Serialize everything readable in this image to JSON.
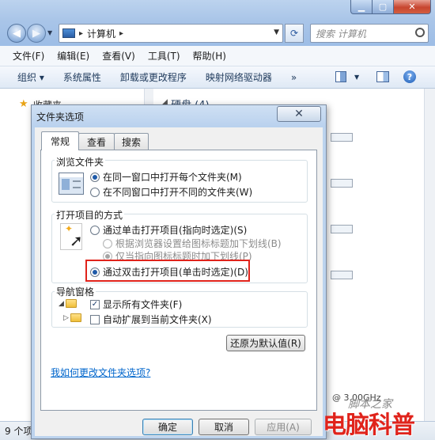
{
  "explorer": {
    "address": {
      "root_label": "计算机"
    },
    "search_placeholder": "搜索 计算机",
    "menu": [
      "文件(F)",
      "编辑(E)",
      "查看(V)",
      "工具(T)",
      "帮助(H)"
    ],
    "commands": [
      "组织 ▾",
      "系统属性",
      "卸载或更改程序",
      "映射网络驱动器",
      "»"
    ],
    "nav_pane": {
      "favorites_label": "收藏夹"
    },
    "content": {
      "group_label": "硬盘 (4)",
      "cpu_text": "@ 3.00GHz"
    },
    "status": {
      "text": "9 个项"
    },
    "watermark": {
      "text": "电脑科普",
      "script": "脚本之家"
    }
  },
  "dialog": {
    "title": "文件夹选项",
    "close_glyph": "✕",
    "tabs": [
      "常规",
      "查看",
      "搜索"
    ],
    "active_tab": 0,
    "browse_group": {
      "label": "浏览文件夹",
      "options": [
        {
          "label": "在同一窗口中打开每个文件夹(M)",
          "selected": true
        },
        {
          "label": "在不同窗口中打开不同的文件夹(W)",
          "selected": false
        }
      ]
    },
    "click_group": {
      "label": "打开项目的方式",
      "single_click": {
        "label": "通过单击打开项目(指向时选定)(S)",
        "selected": false
      },
      "underline_browser": {
        "label": "根据浏览器设置给图标标题加下划线(B)",
        "selected": false
      },
      "underline_point": {
        "label": "仅当指向图标标题时加下划线(P)",
        "selected": true
      },
      "double_click": {
        "label": "通过双击打开项目(单击时选定)(D)",
        "selected": true
      }
    },
    "nav_group": {
      "label": "导航窗格",
      "show_all": {
        "label": "显示所有文件夹(F)",
        "checked": true
      },
      "auto_expand": {
        "label": "自动扩展到当前文件夹(X)",
        "checked": false
      }
    },
    "restore_defaults": "还原为默认值(R)",
    "help_link": "我如何更改文件夹选项?",
    "buttons": {
      "ok": "确定",
      "cancel": "取消",
      "apply": "应用(A)"
    }
  }
}
